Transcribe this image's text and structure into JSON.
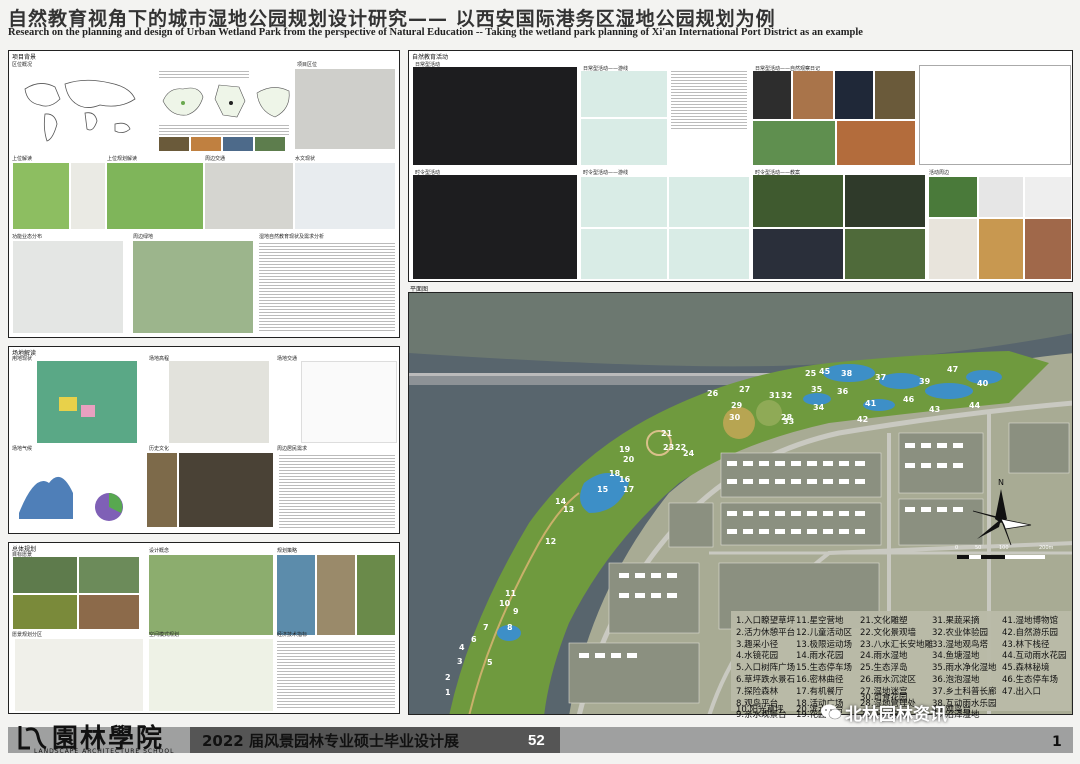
{
  "header": {
    "title_zh": "自然教育视角下的城市湿地公园规划设计研究—— 以西安国际港务区湿地公园规划为例",
    "title_en": "Research on the planning and design of Urban Wetland Park from the perspective of Natural Education -- Taking the wetland park planning of Xi'an International Port District as an example"
  },
  "panels": {
    "background": {
      "title": "项目背景",
      "labels": [
        "区位概况",
        "项目区位",
        "上位解读",
        "上位规划解读",
        "周边交通",
        "水文现状",
        "功能业态分布",
        "周边绿地",
        "湿地自然教育现状及需求分析"
      ]
    },
    "site": {
      "title": "场地解读",
      "labels": [
        "用地现状",
        "场地高程",
        "场地交通",
        "场地气候",
        "历史文化",
        "周边居民需求"
      ]
    },
    "overall": {
      "title": "总体规划",
      "labels": [
        "目标愿景",
        "设计概念",
        "规划策略",
        "愿景规划分区",
        "空间模式规划",
        "经济技术指标"
      ]
    },
    "nature_edu": {
      "title": "自然教育活动",
      "labels": [
        "日常型活动",
        "日常型活动——游线",
        "时令型活动",
        "时令型活动——游线",
        "日常型活动——自然观察日记",
        "时令型活动——教案",
        "活动周边"
      ]
    },
    "plan": {
      "title": "平面图",
      "scale_marks": [
        "0",
        "50",
        "100",
        "200m"
      ]
    }
  },
  "legend": [
    [
      "1.入口瞭望草坪",
      "2.活力休憩平台",
      "3.趣采小径",
      "4.水镜花园",
      "5.入口树阵广场",
      "6.草坪跌水景石",
      "7.探险森林",
      "8.观鸟平台",
      "9.亲水观景台",
      "10.阳光草坪"
    ],
    [
      "11.星空营地",
      "12.儿童活动区",
      "13.极限运动场",
      "14.雨水花园",
      "15.生态停车场",
      "16.密林曲径",
      "17.有机餐厅",
      "18.活动广场",
      "19.花园",
      "20.滨水看台"
    ],
    [
      "21.文化雕塑",
      "22.文化景观墙",
      "23.八水汇长安地雕",
      "24.雨水湿地",
      "25.生态浮岛",
      "26.雨水沉淀区",
      "27.湿地迷宫",
      "28.湿地管理处",
      "29.下沉绿地",
      "30.可食花园"
    ],
    [
      "31.果蔬采摘",
      "32.农业体验园",
      "33.湿地观鸟塔",
      "34.鱼塘湿地",
      "35.雨水净化湿地",
      "36.泡泡湿地",
      "37.乡土科普长廊",
      "38.互动雨水乐园",
      "39.沼泽湿地",
      "40.观鸟台"
    ],
    [
      "41.湿地博物馆",
      "42.自然游乐园",
      "43.林下栈径",
      "44.互动雨水花园",
      "45.森林秘境",
      "46.生态停车场",
      "47.出入口"
    ]
  ],
  "plan_numbers": [
    "1",
    "2",
    "3",
    "4",
    "5",
    "6",
    "7",
    "8",
    "9",
    "10",
    "11",
    "12",
    "13",
    "14",
    "15",
    "16",
    "17",
    "18",
    "19",
    "20",
    "21",
    "22",
    "23",
    "24",
    "25",
    "26",
    "27",
    "28",
    "29",
    "30",
    "31",
    "32",
    "33",
    "34",
    "35",
    "36",
    "37",
    "38",
    "39",
    "40",
    "41",
    "42",
    "43",
    "44",
    "45",
    "46",
    "47"
  ],
  "footer": {
    "school_zh": "園林學院",
    "school_en": "LANDSCAPE ARCHITECTURE SCHOOL",
    "exhibit": "2022 届风景园林专业硕士毕业设计展",
    "exhibit_no": "52",
    "page": "1",
    "watermark": "北林园林资讯"
  },
  "colors": {
    "water": "#4e5f69",
    "park_green": "#6f9a3e",
    "lake": "#3d8fc7",
    "blocks": "#a9ad96",
    "footer_dark": "#555555",
    "hex_pink": "#d7a7b8",
    "hex_navy": "#2d3553"
  }
}
